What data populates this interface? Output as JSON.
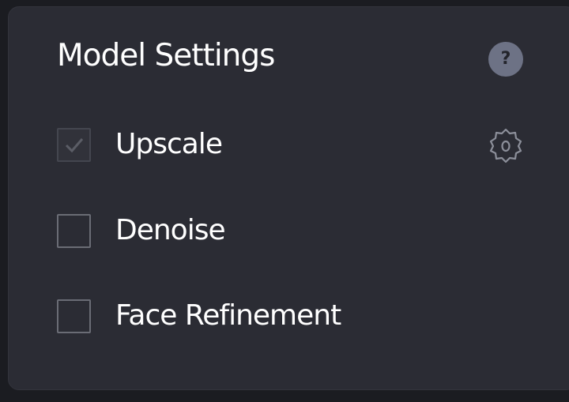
{
  "panel": {
    "title": "Model Settings",
    "help_icon": "question-mark-icon",
    "help_glyph": "?"
  },
  "options": [
    {
      "label": "Upscale",
      "checked": true,
      "disabled": true,
      "settings_icon": "gear-icon"
    },
    {
      "label": "Denoise",
      "checked": false
    },
    {
      "label": "Face Refinement",
      "checked": false
    }
  ],
  "colors": {
    "panel_background": "#2b2c34",
    "page_background": "#1b1c21",
    "text": "#ffffff",
    "help_badge": "#6d7285",
    "checkbox_border": "#6a6c75"
  }
}
